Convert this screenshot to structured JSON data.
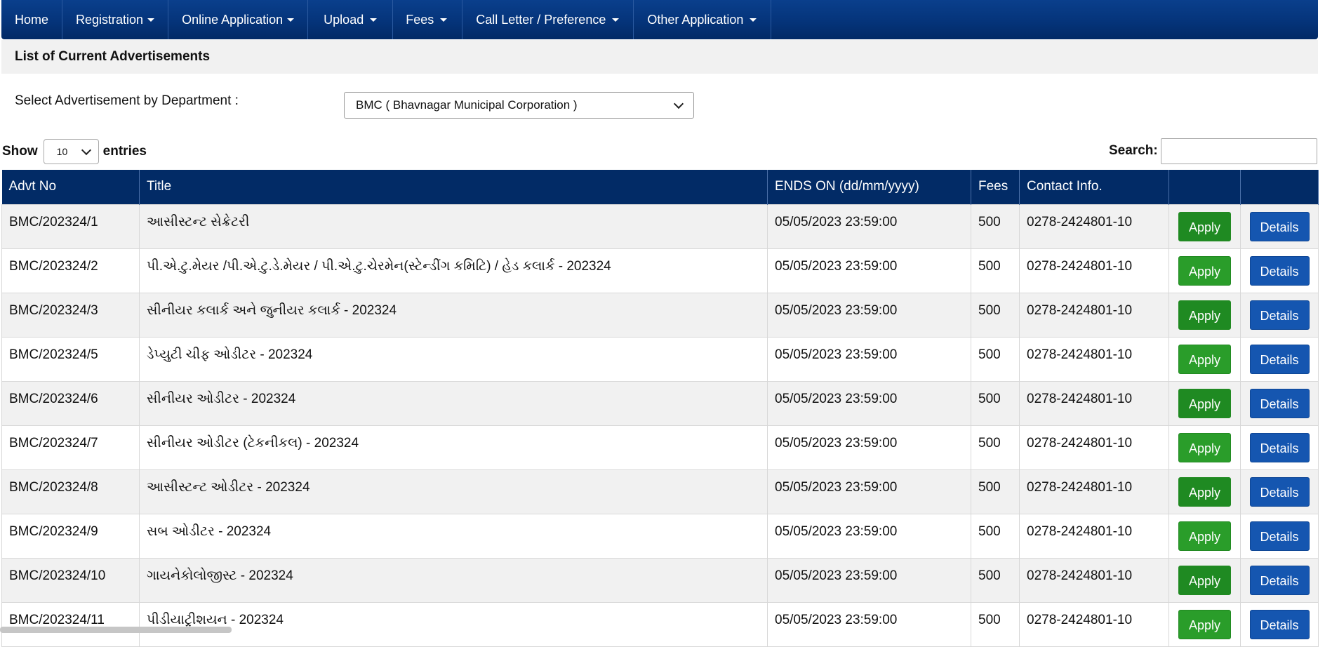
{
  "nav": {
    "items": [
      {
        "label": "Home",
        "dropdown": false
      },
      {
        "label": "Registration",
        "dropdown": true
      },
      {
        "label": "Online Application",
        "dropdown": true
      },
      {
        "label": "Upload",
        "dropdown": true
      },
      {
        "label": "Fees",
        "dropdown": true
      },
      {
        "label": "Call Letter / Preference",
        "dropdown": true
      },
      {
        "label": "Other Application",
        "dropdown": true
      }
    ]
  },
  "page": {
    "heading": "List of Current Advertisements",
    "dept_label": "Select Advertisement by Department :",
    "dept_selected": "BMC ( Bhavnagar Municipal Corporation )"
  },
  "table_controls": {
    "show_label": "Show",
    "entries_value": "10",
    "entries_label": "entries",
    "search_label": "Search:",
    "search_value": ""
  },
  "table": {
    "headers": [
      "Advt No",
      "Title",
      "ENDS ON (dd/mm/yyyy)",
      "Fees",
      "Contact Info.",
      "",
      ""
    ],
    "apply_label": "Apply",
    "details_label": "Details",
    "rows": [
      {
        "advt_no": "BMC/202324/1",
        "title": "આસીસ્ટન્ટ સેક્રેટરી",
        "ends_on": "05/05/2023 23:59:00",
        "fees": "500",
        "contact": "0278-2424801-10"
      },
      {
        "advt_no": "BMC/202324/2",
        "title": "પી.એ.ટુ.મેયર /પી.એ.ટુ.ડે.મેયર / પી.એ.ટુ.ચેરમેન(સ્ટેન્ડીંગ કમિટિ) / હેડ કલાર્ક - 202324",
        "ends_on": "05/05/2023 23:59:00",
        "fees": "500",
        "contact": "0278-2424801-10"
      },
      {
        "advt_no": "BMC/202324/3",
        "title": "સીનીયર કલાર્ક અને જુનીયર કલાર્ક - 202324",
        "ends_on": "05/05/2023 23:59:00",
        "fees": "500",
        "contact": "0278-2424801-10"
      },
      {
        "advt_no": "BMC/202324/5",
        "title": "ડેપ્યુટી ચીફ ઓડીટર - 202324",
        "ends_on": "05/05/2023 23:59:00",
        "fees": "500",
        "contact": "0278-2424801-10"
      },
      {
        "advt_no": "BMC/202324/6",
        "title": "સીનીયર ઓડીટર - 202324",
        "ends_on": "05/05/2023 23:59:00",
        "fees": "500",
        "contact": "0278-2424801-10"
      },
      {
        "advt_no": "BMC/202324/7",
        "title": "સીનીયર ઓડીટર (ટેકનીકલ) - 202324",
        "ends_on": "05/05/2023 23:59:00",
        "fees": "500",
        "contact": "0278-2424801-10"
      },
      {
        "advt_no": "BMC/202324/8",
        "title": "આસીસ્ટન્ટ ઓડીટર - 202324",
        "ends_on": "05/05/2023 23:59:00",
        "fees": "500",
        "contact": "0278-2424801-10"
      },
      {
        "advt_no": "BMC/202324/9",
        "title": "સબ ઓડીટર - 202324",
        "ends_on": "05/05/2023 23:59:00",
        "fees": "500",
        "contact": "0278-2424801-10"
      },
      {
        "advt_no": "BMC/202324/10",
        "title": "ગાયનેકોલોજીસ્ટ - 202324",
        "ends_on": "05/05/2023 23:59:00",
        "fees": "500",
        "contact": "0278-2424801-10"
      },
      {
        "advt_no": "BMC/202324/11",
        "title": "પીડીયાટ્રીશયન - 202324",
        "ends_on": "05/05/2023 23:59:00",
        "fees": "500",
        "contact": "0278-2424801-10"
      }
    ]
  },
  "colors": {
    "nav_bg": "#05347a",
    "table_header_bg": "#022b66",
    "apply_green": "#2a9d2a",
    "details_blue": "#1556b0"
  }
}
